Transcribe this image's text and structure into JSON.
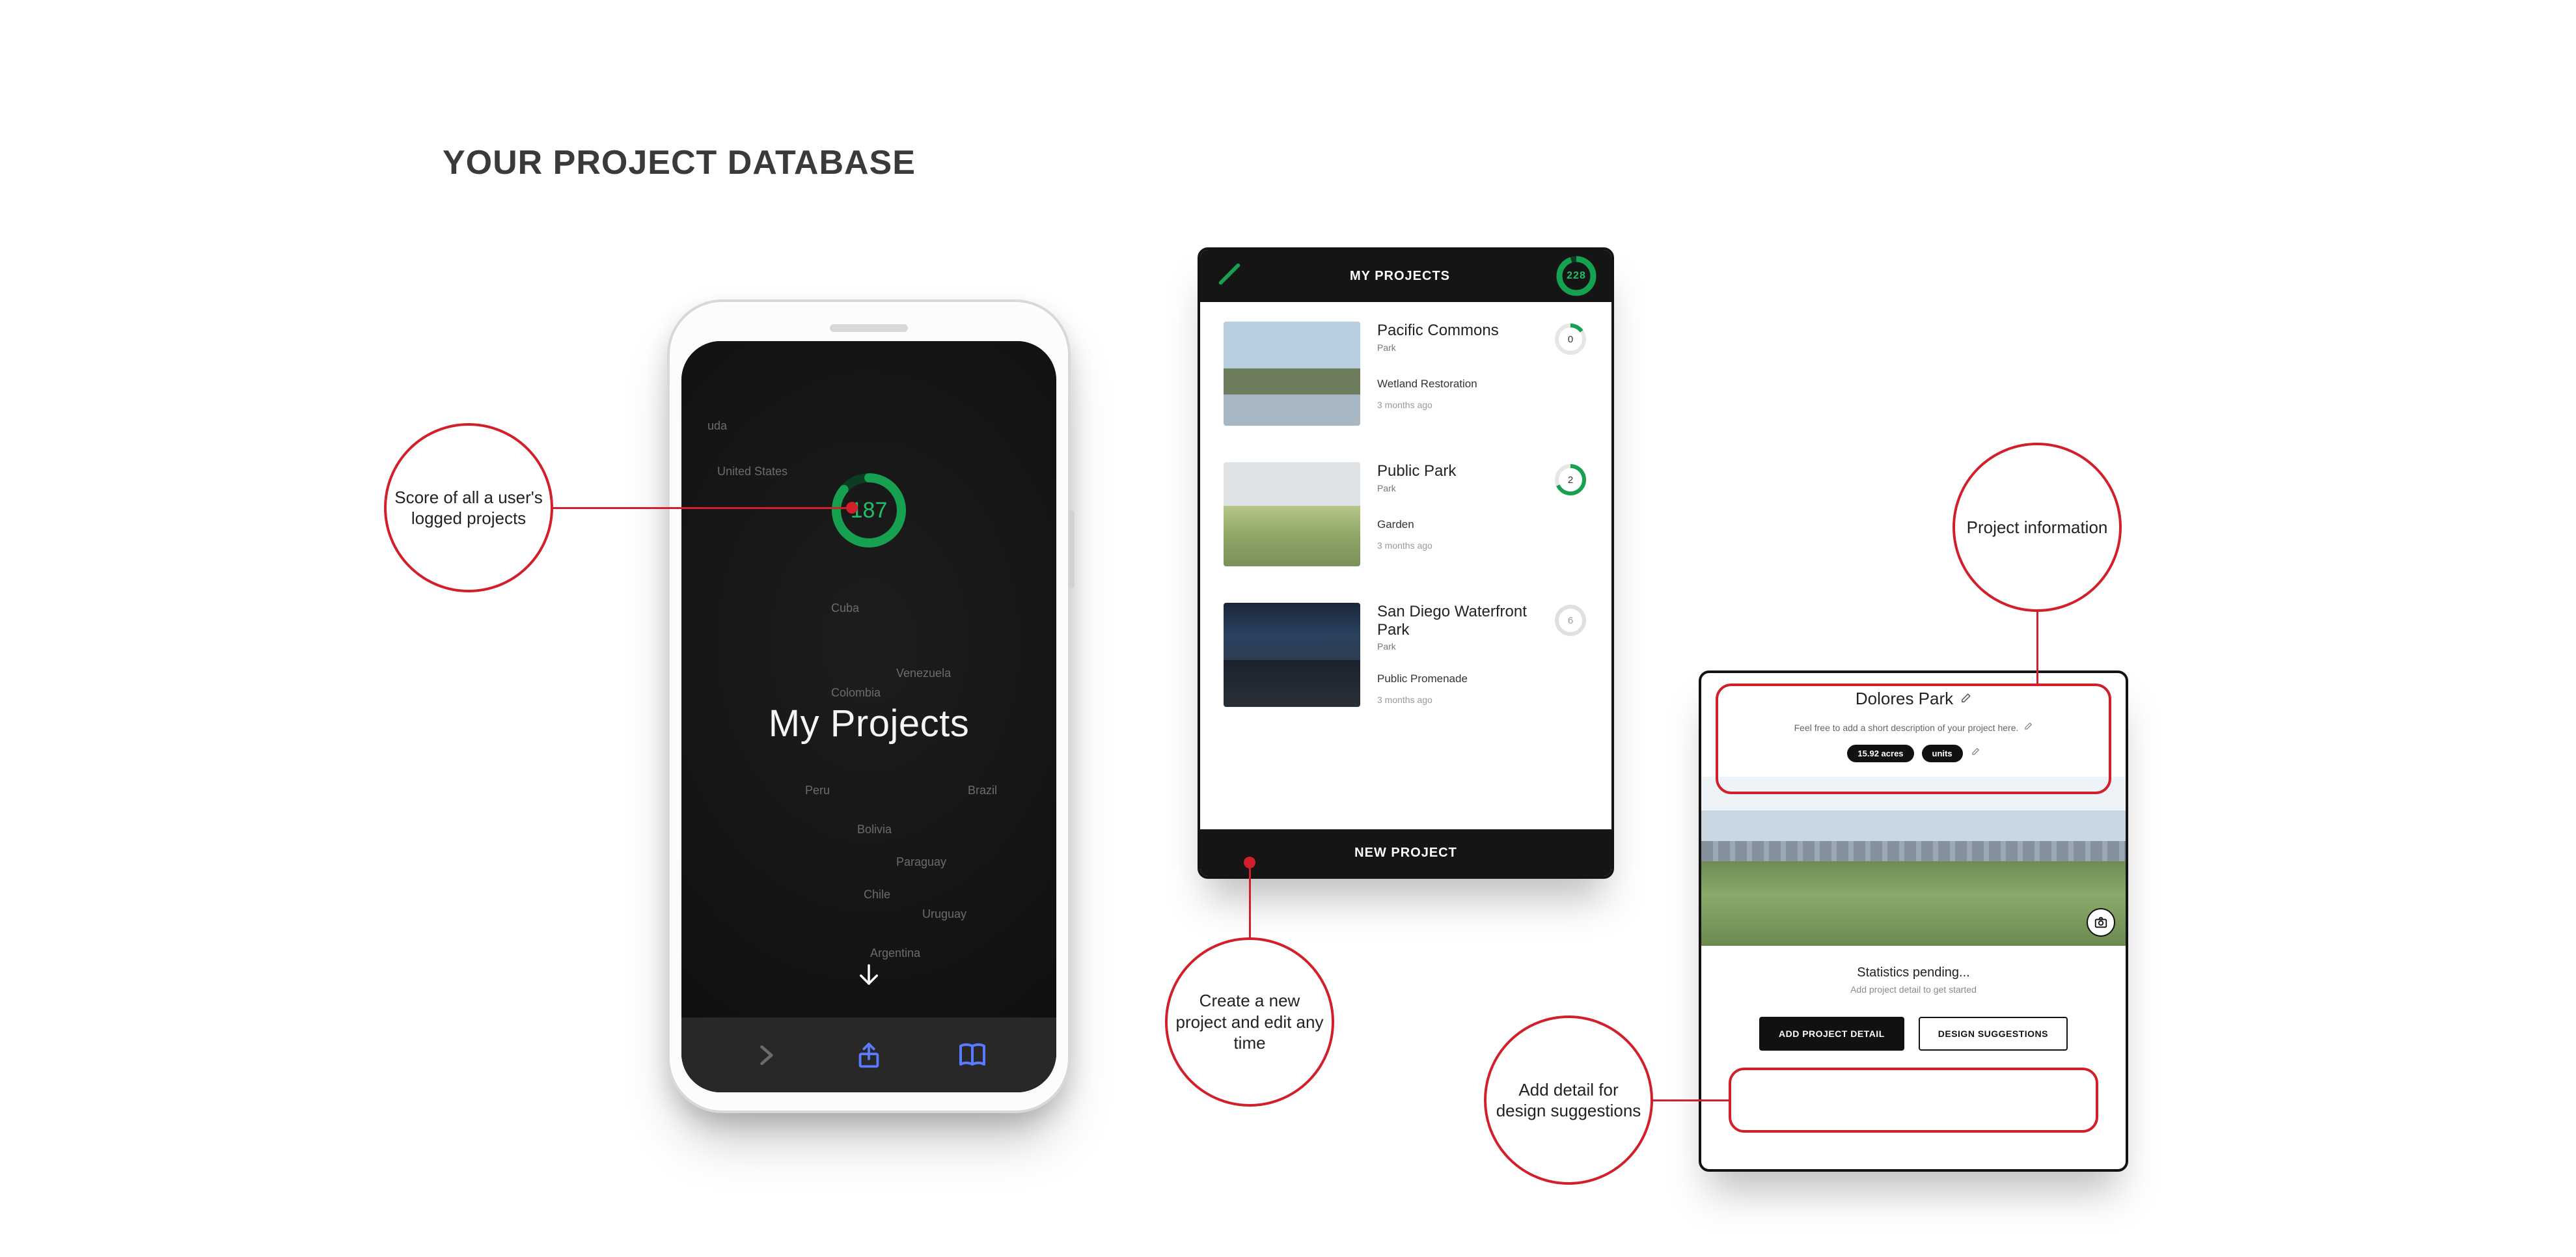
{
  "heading": "YOUR PROJECT DATABASE",
  "phone": {
    "score": "187",
    "title": "My Projects",
    "map_labels": [
      "United States",
      "Cuba",
      "Venezuela",
      "Colombia",
      "Brazil",
      "Peru",
      "Bolivia",
      "Paraguay",
      "Chile",
      "Uruguay",
      "Argentina",
      "uda"
    ]
  },
  "list": {
    "header": "MY PROJECTS",
    "header_score": "228",
    "projects": [
      {
        "name": "Pacific Commons",
        "type": "Park",
        "subtitle": "Wetland Restoration",
        "ago": "3 months ago",
        "score": "0",
        "ring_color": "#16a150"
      },
      {
        "name": "Public Park",
        "type": "Park",
        "subtitle": "Garden",
        "ago": "3 months ago",
        "score": "2",
        "ring_color": "#16a150"
      },
      {
        "name": "San Diego Waterfront Park",
        "type": "Park",
        "subtitle": "Public Promenade",
        "ago": "3 months ago",
        "score": "6",
        "ring_color": "#bdbdbd"
      }
    ],
    "footer": "NEW PROJECT"
  },
  "detail": {
    "title": "Dolores Park",
    "desc": "Feel free to add a short description of your project here.",
    "size_pill": "15.92 acres",
    "units_pill": "units",
    "stats_line1": "Statistics pending...",
    "stats_line2": "Add project detail to get started",
    "btn_primary": "ADD PROJECT DETAIL",
    "btn_secondary": "DESIGN SUGGESTIONS"
  },
  "callouts": {
    "score_total": "Score of all a user's logged projects",
    "new_project": "Create a new project and edit any time",
    "project_info": "Project information",
    "add_detail": "Add detail for design suggestions"
  },
  "colors": {
    "accent_green": "#16a150",
    "callout_red": "#d2202a"
  }
}
